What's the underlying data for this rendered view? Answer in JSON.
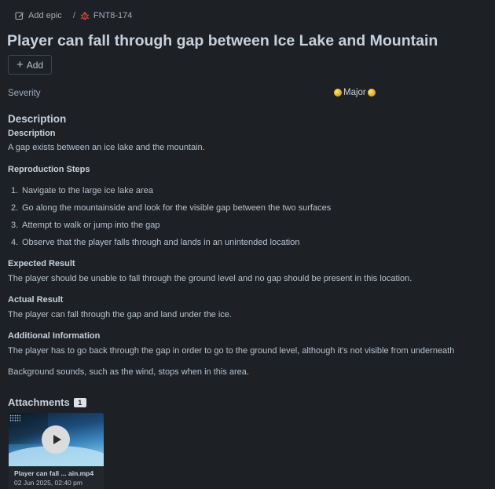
{
  "breadcrumb": {
    "add_epic_label": "Add epic",
    "separator": "/",
    "issue_key": "FNT8-174",
    "issue_type_icon_color": "#e5493a"
  },
  "title": "Player can fall through gap between Ice Lake and Mountain",
  "add_button_label": "Add",
  "severity": {
    "label": "Severity",
    "value": "Major",
    "icon_color": "#f5b400"
  },
  "description": {
    "heading": "Description",
    "sub_heading": "Description",
    "text": "A gap exists between an ice lake and the mountain.",
    "reproduction_heading": "Reproduction Steps",
    "steps": [
      "Navigate to the large ice lake area",
      "Go along the mountainside and look for the visible gap between the two surfaces",
      "Attempt to walk or jump into the gap",
      "Observe that the player falls through and lands in an unintended location"
    ],
    "expected_heading": "Expected Result",
    "expected_text": "The player should be unable to fall through the ground level and no gap should be present in this location.",
    "actual_heading": "Actual Result",
    "actual_text": "The player can fall through the gap and land under the ice.",
    "additional_heading": "Additional Information",
    "additional_text_1": "The player has to go back through the gap in order to go to the ground level, although it's not visible from underneath",
    "additional_text_2": "Background sounds, such as the wind, stops when in this area."
  },
  "attachments": {
    "heading": "Attachments",
    "count": "1",
    "items": [
      {
        "name": "Player can fall ... ain.mp4",
        "date": "02 Jun 2025, 02:40 pm"
      }
    ]
  }
}
